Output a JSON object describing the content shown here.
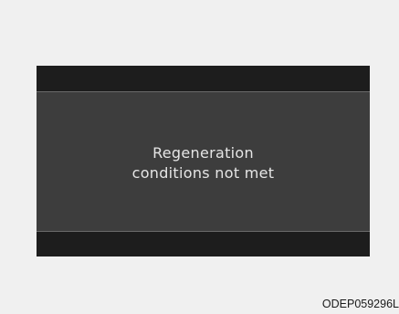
{
  "display": {
    "message_line1": "Regeneration",
    "message_line2": "conditions not met"
  },
  "figure": {
    "code": "ODEP059296L"
  },
  "colors": {
    "panel_background": "#f0f0f0",
    "display_bezel": "#1d1d1d",
    "display_screen": "#3d3d3d",
    "message_text": "#e6e6e6"
  }
}
